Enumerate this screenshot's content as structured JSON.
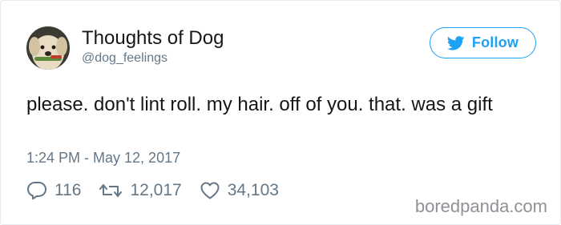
{
  "tweet": {
    "author": {
      "display_name": "Thoughts of Dog",
      "handle": "@dog_feelings",
      "avatar_icon": "dog-avatar"
    },
    "follow_button": {
      "label": "Follow",
      "icon": "twitter-bird-icon",
      "color": "#1da1f2"
    },
    "text": "please. don't lint roll. my hair. off of you. that. was a gift",
    "timestamp": "1:24 PM - May 12, 2017",
    "actions": {
      "replies": {
        "icon": "reply-icon",
        "count": "116"
      },
      "retweets": {
        "icon": "retweet-icon",
        "count": "12,017"
      },
      "likes": {
        "icon": "heart-icon",
        "count": "34,103"
      }
    }
  },
  "watermark": "boredpanda.com",
  "colors": {
    "text_primary": "#14171a",
    "text_secondary": "#657786",
    "accent": "#1da1f2",
    "border": "#e6ecf0"
  }
}
